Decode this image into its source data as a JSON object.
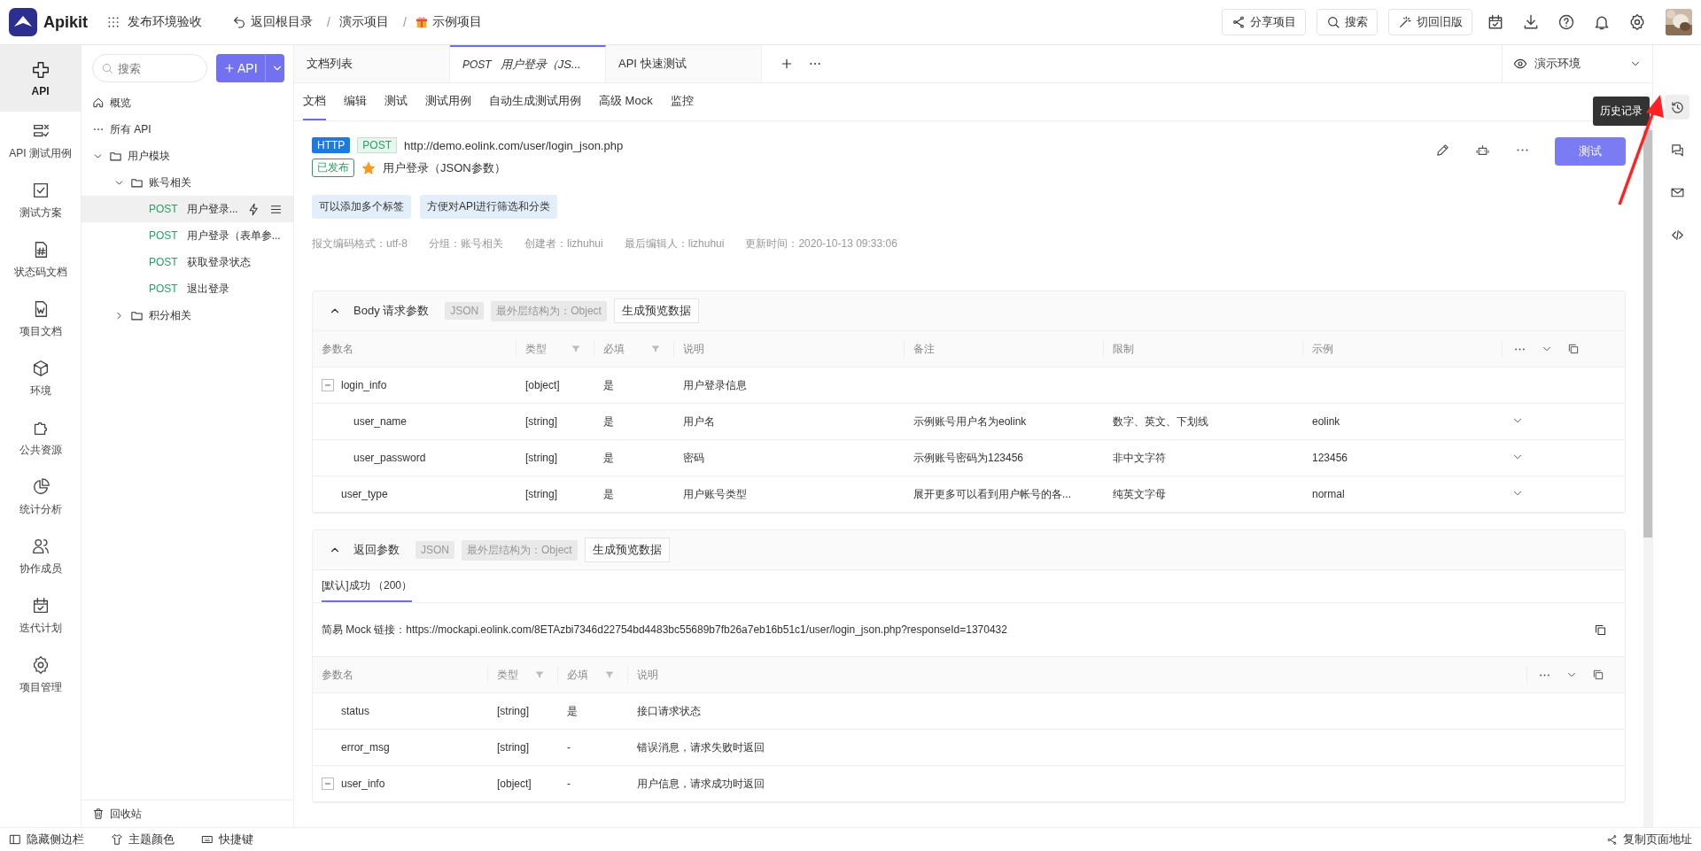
{
  "app": {
    "name": "Apikit",
    "workspace": "发布环境验收"
  },
  "breadcrumb": [
    {
      "label": "返回根目录",
      "kind": "back"
    },
    {
      "separator": "/",
      "label": "演示项目",
      "kind": "plain"
    },
    {
      "separator": "/",
      "label": "示例项目",
      "kind": "gift"
    }
  ],
  "top_actions": [
    {
      "label": "分享项目",
      "kind": "share"
    },
    {
      "label": "搜索",
      "kind": "search"
    },
    {
      "label": "切回旧版",
      "kind": "wand"
    }
  ],
  "top_icons": [
    {
      "kind": "calendar"
    },
    {
      "kind": "download"
    },
    {
      "kind": "help"
    },
    {
      "kind": "bell"
    },
    {
      "kind": "settings"
    }
  ],
  "nav": [
    {
      "label": "API",
      "kind": "api",
      "selected": true
    },
    {
      "label": "API 测试用例",
      "kind": "testcase",
      "selected": false
    },
    {
      "label": "测试方案",
      "kind": "plan",
      "selected": false
    },
    {
      "label": "状态码文档",
      "kind": "statuscode",
      "selected": false
    },
    {
      "label": "项目文档",
      "kind": "doc",
      "selected": false
    },
    {
      "label": "环境",
      "kind": "env",
      "selected": false
    },
    {
      "label": "公共资源",
      "kind": "resource",
      "selected": false
    },
    {
      "label": "统计分析",
      "kind": "stats",
      "selected": false
    },
    {
      "label": "协作成员",
      "kind": "members",
      "selected": false
    },
    {
      "label": "迭代计划",
      "kind": "iteration",
      "selected": false
    },
    {
      "label": "项目管理",
      "kind": "manage",
      "selected": false
    }
  ],
  "tree": {
    "search": {
      "placeholder": "搜索"
    },
    "add_button": "API",
    "items": [
      {
        "kind": "overview",
        "label": "概览"
      },
      {
        "kind": "all",
        "label": "所有 API"
      },
      {
        "kind": "folder",
        "label": "用户模块",
        "expanded": true,
        "children": [
          {
            "kind": "folder",
            "label": "账号相关",
            "expanded": true,
            "children": [
              {
                "kind": "api",
                "method": "POST",
                "label": "用户登录...",
                "selected": true
              },
              {
                "kind": "api",
                "method": "POST",
                "label": "用户登录（表单参...",
                "selected": false
              },
              {
                "kind": "api",
                "method": "POST",
                "label": "获取登录状态",
                "selected": false
              },
              {
                "kind": "api",
                "method": "POST",
                "label": "退出登录",
                "selected": false
              }
            ]
          },
          {
            "kind": "folder",
            "label": "积分相关",
            "expanded": false
          }
        ]
      }
    ],
    "recycle": "回收站"
  },
  "doc_tabs": [
    {
      "label": "文档列表",
      "selected": false
    },
    {
      "method": "POST",
      "label": "用户登录（JS...",
      "selected": true
    },
    {
      "label": "API 快速测试",
      "selected": false
    }
  ],
  "environment": "演示环境",
  "sub_tabs": [
    {
      "label": "文档",
      "selected": true
    },
    {
      "label": "编辑",
      "selected": false
    },
    {
      "label": "测试",
      "selected": false
    },
    {
      "label": "测试用例",
      "selected": false
    },
    {
      "label": "自动生成测试用例",
      "selected": false
    },
    {
      "label": "高级 Mock",
      "selected": false
    },
    {
      "label": "监控",
      "selected": false
    }
  ],
  "api": {
    "protocol": "HTTP",
    "method": "POST",
    "url": "http://demo.eolink.com/user/login_json.php",
    "status": "已发布",
    "starred": true,
    "name": "用户登录（JSON参数）",
    "test_button": "测试",
    "tags": [
      "可以添加多个标签",
      "方便对API进行筛选和分类"
    ],
    "meta": [
      "报文编码格式：utf-8",
      "分组：账号相关",
      "创建者：lizhuhui",
      "最后编辑人：lizhuhui",
      "更新时间：2020-10-13 09:33:06"
    ]
  },
  "body_params": {
    "title": "Body 请求参数",
    "format": "JSON",
    "structure": "最外层结构为：Object",
    "preview_button": "生成预览数据",
    "columns": [
      {
        "label": "参数名",
        "filter": false
      },
      {
        "label": "类型",
        "filter": true
      },
      {
        "label": "必填",
        "filter": true
      },
      {
        "label": "说明",
        "filter": false
      },
      {
        "label": "备注",
        "filter": false
      },
      {
        "label": "限制",
        "filter": false
      },
      {
        "label": "示例",
        "filter": false
      }
    ],
    "rows": [
      {
        "name": "login_info",
        "type": "[object]",
        "required": "是",
        "description": "用户登录信息",
        "expanded": true,
        "children": [
          {
            "name": "user_name",
            "type": "[string]",
            "required": "是",
            "description": "用户名",
            "note": "示例账号用户名为eolink",
            "limit": "数字、英文、下划线",
            "example": "eolink"
          },
          {
            "name": "user_password",
            "type": "[string]",
            "required": "是",
            "description": "密码",
            "note": "示例账号密码为123456",
            "limit": "非中文字符",
            "example": "123456"
          }
        ]
      },
      {
        "name": "user_type",
        "type": "[string]",
        "required": "是",
        "description": "用户账号类型",
        "note": "展开更多可以看到用户帐号的各...",
        "limit": "纯英文字母",
        "example": "normal"
      }
    ]
  },
  "response": {
    "title": "返回参数",
    "format": "JSON",
    "structure": "最外层结构为：Object",
    "preview_button": "生成预览数据",
    "tabs": [
      {
        "label": "[默认]成功 （200）",
        "selected": true
      }
    ],
    "mock_label": "简易 Mock 链接：",
    "mock_url": "https://mockapi.eolink.com/8ETAzbi7346d22754bd4483bc55689b7fb26a7eb16b51c1/user/login_json.php?responseId=1370432",
    "columns": [
      {
        "label": "参数名",
        "filter": false
      },
      {
        "label": "类型",
        "filter": true
      },
      {
        "label": "必填",
        "filter": true
      },
      {
        "label": "说明",
        "filter": false
      }
    ],
    "rows": [
      {
        "name": "status",
        "type": "[string]",
        "required": "是",
        "description": "接口请求状态"
      },
      {
        "name": "error_msg",
        "type": "[string]",
        "required": "-",
        "description": "错误消息，请求失败时返回"
      },
      {
        "name": "user_info",
        "type": "[object]",
        "required": "-",
        "description": "用户信息，请求成功时返回",
        "expanded": true
      }
    ]
  },
  "right_rail": {
    "tooltip": "历史记录",
    "icons": [
      {
        "kind": "history"
      },
      {
        "kind": "comment"
      },
      {
        "kind": "mail"
      },
      {
        "kind": "code"
      }
    ]
  },
  "bottom_bar": {
    "items": [
      {
        "label": "隐藏侧边栏",
        "kind": "sidebar"
      },
      {
        "label": "主题颜色",
        "kind": "shirt"
      },
      {
        "label": "快捷键",
        "kind": "keyboard"
      }
    ],
    "copy_link": "复制页面地址"
  }
}
